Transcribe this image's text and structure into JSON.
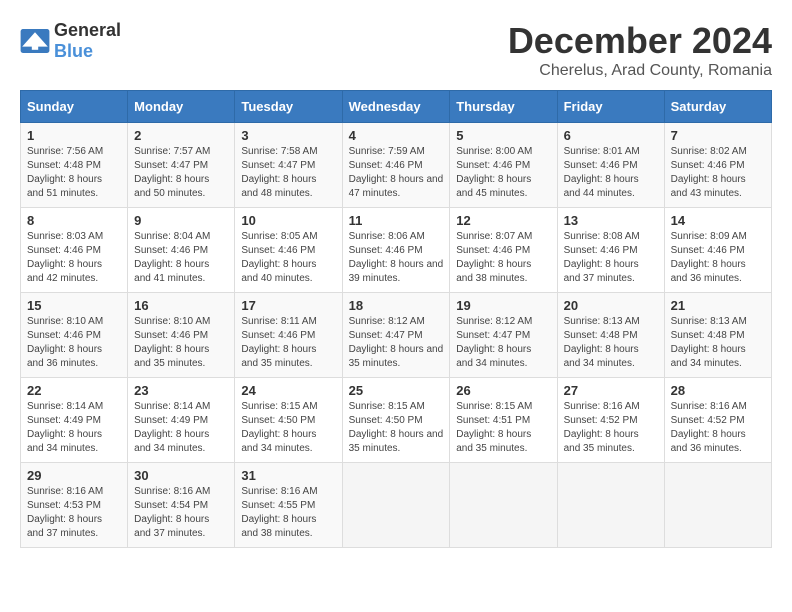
{
  "header": {
    "logo_general": "General",
    "logo_blue": "Blue",
    "title": "December 2024",
    "subtitle": "Cherelus, Arad County, Romania"
  },
  "calendar": {
    "days_of_week": [
      "Sunday",
      "Monday",
      "Tuesday",
      "Wednesday",
      "Thursday",
      "Friday",
      "Saturday"
    ],
    "weeks": [
      [
        {
          "day": "1",
          "sunrise": "7:56 AM",
          "sunset": "4:48 PM",
          "daylight": "8 hours and 51 minutes."
        },
        {
          "day": "2",
          "sunrise": "7:57 AM",
          "sunset": "4:47 PM",
          "daylight": "8 hours and 50 minutes."
        },
        {
          "day": "3",
          "sunrise": "7:58 AM",
          "sunset": "4:47 PM",
          "daylight": "8 hours and 48 minutes."
        },
        {
          "day": "4",
          "sunrise": "7:59 AM",
          "sunset": "4:46 PM",
          "daylight": "8 hours and 47 minutes."
        },
        {
          "day": "5",
          "sunrise": "8:00 AM",
          "sunset": "4:46 PM",
          "daylight": "8 hours and 45 minutes."
        },
        {
          "day": "6",
          "sunrise": "8:01 AM",
          "sunset": "4:46 PM",
          "daylight": "8 hours and 44 minutes."
        },
        {
          "day": "7",
          "sunrise": "8:02 AM",
          "sunset": "4:46 PM",
          "daylight": "8 hours and 43 minutes."
        }
      ],
      [
        {
          "day": "8",
          "sunrise": "8:03 AM",
          "sunset": "4:46 PM",
          "daylight": "8 hours and 42 minutes."
        },
        {
          "day": "9",
          "sunrise": "8:04 AM",
          "sunset": "4:46 PM",
          "daylight": "8 hours and 41 minutes."
        },
        {
          "day": "10",
          "sunrise": "8:05 AM",
          "sunset": "4:46 PM",
          "daylight": "8 hours and 40 minutes."
        },
        {
          "day": "11",
          "sunrise": "8:06 AM",
          "sunset": "4:46 PM",
          "daylight": "8 hours and 39 minutes."
        },
        {
          "day": "12",
          "sunrise": "8:07 AM",
          "sunset": "4:46 PM",
          "daylight": "8 hours and 38 minutes."
        },
        {
          "day": "13",
          "sunrise": "8:08 AM",
          "sunset": "4:46 PM",
          "daylight": "8 hours and 37 minutes."
        },
        {
          "day": "14",
          "sunrise": "8:09 AM",
          "sunset": "4:46 PM",
          "daylight": "8 hours and 36 minutes."
        }
      ],
      [
        {
          "day": "15",
          "sunrise": "8:10 AM",
          "sunset": "4:46 PM",
          "daylight": "8 hours and 36 minutes."
        },
        {
          "day": "16",
          "sunrise": "8:10 AM",
          "sunset": "4:46 PM",
          "daylight": "8 hours and 35 minutes."
        },
        {
          "day": "17",
          "sunrise": "8:11 AM",
          "sunset": "4:46 PM",
          "daylight": "8 hours and 35 minutes."
        },
        {
          "day": "18",
          "sunrise": "8:12 AM",
          "sunset": "4:47 PM",
          "daylight": "8 hours and 35 minutes."
        },
        {
          "day": "19",
          "sunrise": "8:12 AM",
          "sunset": "4:47 PM",
          "daylight": "8 hours and 34 minutes."
        },
        {
          "day": "20",
          "sunrise": "8:13 AM",
          "sunset": "4:48 PM",
          "daylight": "8 hours and 34 minutes."
        },
        {
          "day": "21",
          "sunrise": "8:13 AM",
          "sunset": "4:48 PM",
          "daylight": "8 hours and 34 minutes."
        }
      ],
      [
        {
          "day": "22",
          "sunrise": "8:14 AM",
          "sunset": "4:49 PM",
          "daylight": "8 hours and 34 minutes."
        },
        {
          "day": "23",
          "sunrise": "8:14 AM",
          "sunset": "4:49 PM",
          "daylight": "8 hours and 34 minutes."
        },
        {
          "day": "24",
          "sunrise": "8:15 AM",
          "sunset": "4:50 PM",
          "daylight": "8 hours and 34 minutes."
        },
        {
          "day": "25",
          "sunrise": "8:15 AM",
          "sunset": "4:50 PM",
          "daylight": "8 hours and 35 minutes."
        },
        {
          "day": "26",
          "sunrise": "8:15 AM",
          "sunset": "4:51 PM",
          "daylight": "8 hours and 35 minutes."
        },
        {
          "day": "27",
          "sunrise": "8:16 AM",
          "sunset": "4:52 PM",
          "daylight": "8 hours and 35 minutes."
        },
        {
          "day": "28",
          "sunrise": "8:16 AM",
          "sunset": "4:52 PM",
          "daylight": "8 hours and 36 minutes."
        }
      ],
      [
        {
          "day": "29",
          "sunrise": "8:16 AM",
          "sunset": "4:53 PM",
          "daylight": "8 hours and 37 minutes."
        },
        {
          "day": "30",
          "sunrise": "8:16 AM",
          "sunset": "4:54 PM",
          "daylight": "8 hours and 37 minutes."
        },
        {
          "day": "31",
          "sunrise": "8:16 AM",
          "sunset": "4:55 PM",
          "daylight": "8 hours and 38 minutes."
        },
        null,
        null,
        null,
        null
      ]
    ]
  }
}
